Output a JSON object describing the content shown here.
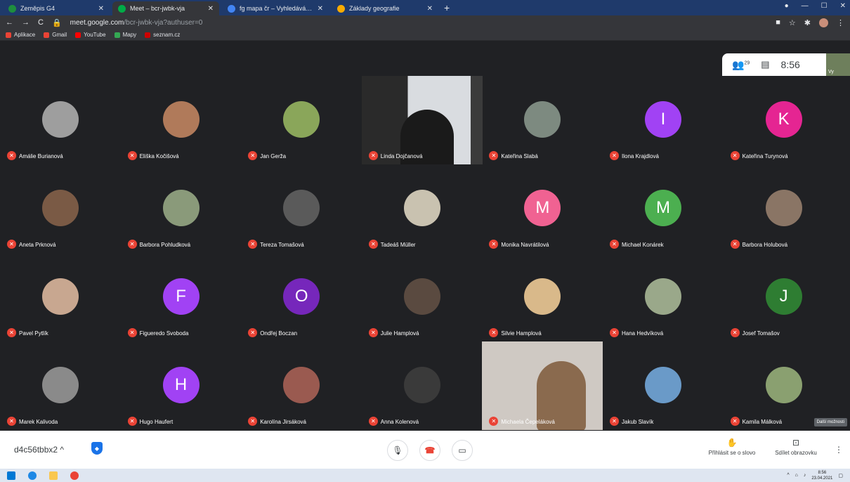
{
  "browser": {
    "tabs": [
      {
        "title": "Zeměpis G4",
        "favicon_color": "#1e8e3e",
        "active": false
      },
      {
        "title": "Meet – bcr-jwbk-vja",
        "favicon_color": "#00ac47",
        "active": true
      },
      {
        "title": "fg mapa čr – Vyhledávání Google",
        "favicon_color": "#4285f4",
        "active": false
      },
      {
        "title": "Základy geografie",
        "favicon_color": "#f9ab00",
        "active": false
      }
    ],
    "url_host": "meet.google.com",
    "url_path": "/bcr-jwbk-vja?authuser=0",
    "bookmarks": [
      {
        "label": "Aplikace",
        "color": "#ea4335"
      },
      {
        "label": "Gmail",
        "color": "#ea4335"
      },
      {
        "label": "YouTube",
        "color": "#ff0000"
      },
      {
        "label": "Mapy",
        "color": "#34a853"
      },
      {
        "label": "seznam.cz",
        "color": "#cc0000"
      }
    ]
  },
  "meet": {
    "participant_count": "29",
    "clock": "8:56",
    "self_label": "Vy",
    "participants": [
      {
        "name": "Amálie Burianová",
        "avatar_type": "photo",
        "color": "#9e9e9e"
      },
      {
        "name": "Eliška Kočišová",
        "avatar_type": "photo",
        "color": "#b07a5a"
      },
      {
        "name": "Jan Gerža",
        "avatar_type": "photo",
        "color": "#8aa65a"
      },
      {
        "name": "Linda Dojčanová",
        "avatar_type": "video",
        "color": "#2a2a2a"
      },
      {
        "name": "Kateřina Slabá",
        "avatar_type": "photo",
        "color": "#7d8a80"
      },
      {
        "name": "Ilona Krajdlová",
        "avatar_type": "letter",
        "letter": "I",
        "color": "#a142f4"
      },
      {
        "name": "Kateřina Turynová",
        "avatar_type": "letter",
        "letter": "K",
        "color": "#e52592"
      },
      {
        "name": "Aneta Prknová",
        "avatar_type": "photo",
        "color": "#7a5a45"
      },
      {
        "name": "Barbora Pohludková",
        "avatar_type": "photo",
        "color": "#8a9a7a"
      },
      {
        "name": "Tereza Tomašová",
        "avatar_type": "photo",
        "color": "#5a5a5a"
      },
      {
        "name": "Tadeáš Müller",
        "avatar_type": "photo",
        "color": "#c9c2b0"
      },
      {
        "name": "Monika Navrátilová",
        "avatar_type": "letter",
        "letter": "M",
        "color": "#f06292"
      },
      {
        "name": "Michael Konárek",
        "avatar_type": "letter",
        "letter": "M",
        "color": "#4caf50"
      },
      {
        "name": "Barbora Holubová",
        "avatar_type": "photo",
        "color": "#8a7565"
      },
      {
        "name": "Pavel Pytlík",
        "avatar_type": "photo",
        "color": "#c8a790"
      },
      {
        "name": "Figueredo Svoboda",
        "avatar_type": "letter",
        "letter": "F",
        "color": "#a142f4"
      },
      {
        "name": "Ondřej Boczan",
        "avatar_type": "letter",
        "letter": "O",
        "color": "#7627bb"
      },
      {
        "name": "Julie Hamplová",
        "avatar_type": "photo",
        "color": "#5a4a40"
      },
      {
        "name": "Silvie Hamplová",
        "avatar_type": "photo",
        "color": "#d9b98a"
      },
      {
        "name": "Hana Hedvíková",
        "avatar_type": "photo",
        "color": "#9aa88a"
      },
      {
        "name": "Josef Tomašov",
        "avatar_type": "letter",
        "letter": "J",
        "color": "#2e7d32"
      },
      {
        "name": "Marek Kalivoda",
        "avatar_type": "photo",
        "color": "#8a8a8a"
      },
      {
        "name": "Hugo Haufert",
        "avatar_type": "letter",
        "letter": "H",
        "color": "#a142f4"
      },
      {
        "name": "Karolína Jirsáková",
        "avatar_type": "photo",
        "color": "#9a5a50"
      },
      {
        "name": "Anna Kolenová",
        "avatar_type": "photo",
        "color": "#3a3a3a"
      },
      {
        "name": "Michaela Čepeláková",
        "avatar_type": "video",
        "color": "#cfc9c3"
      },
      {
        "name": "Jakub Slavík",
        "avatar_type": "photo",
        "color": "#6a9ac8"
      },
      {
        "name": "Kamila Málková",
        "avatar_type": "photo",
        "color": "#8aa070"
      }
    ],
    "tooltip": "Další možnosti",
    "meeting_code": "d4c56tbbx2",
    "raise_hand_label": "Přihlásit se o slovo",
    "present_label": "Sdílet obrazovku"
  },
  "taskbar": {
    "time": "8:56",
    "date": "23.04.2021"
  }
}
